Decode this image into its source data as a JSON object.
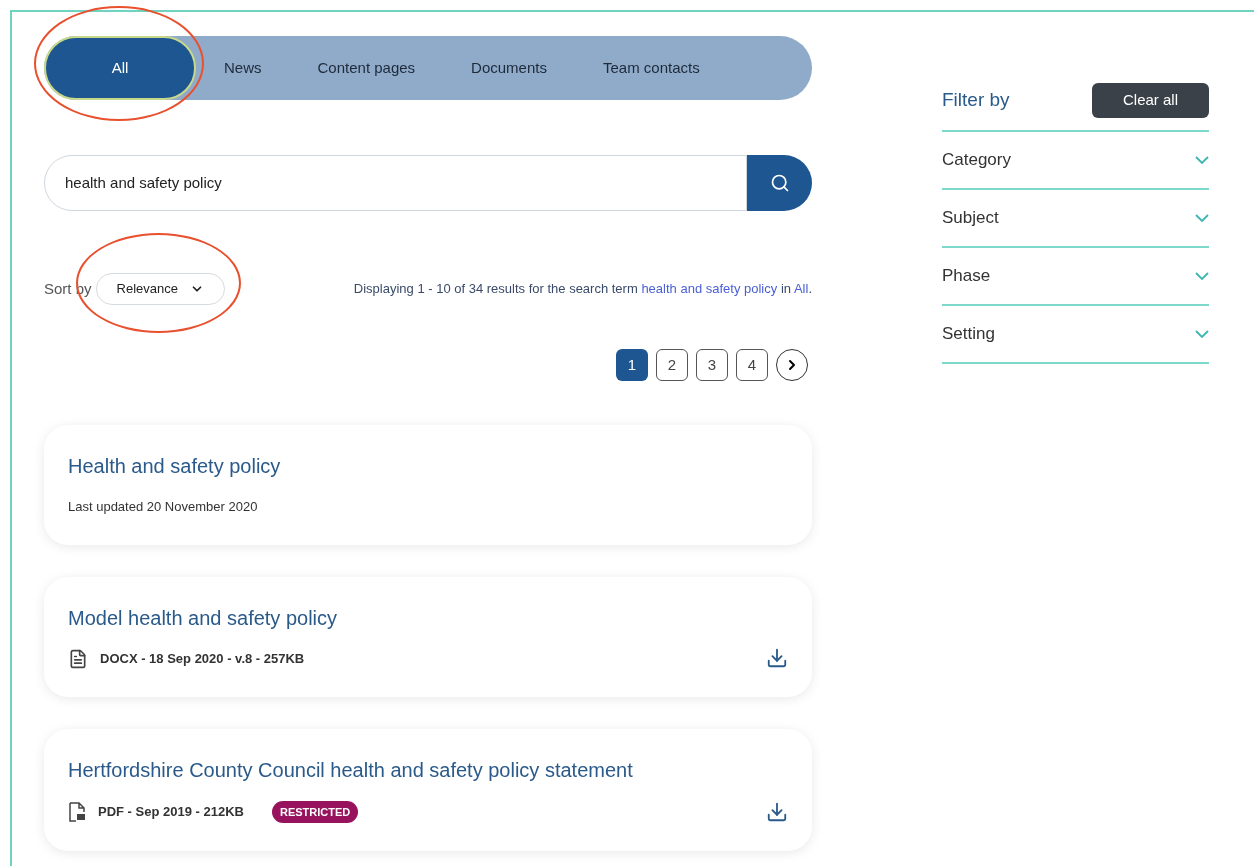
{
  "tabs": [
    {
      "label": "All",
      "selected": true,
      "circled": true
    },
    {
      "label": "News",
      "selected": false,
      "circled": false
    },
    {
      "label": "Content pages",
      "selected": false,
      "circled": false
    },
    {
      "label": "Documents",
      "selected": false,
      "circled": false
    },
    {
      "label": "Team contacts",
      "selected": false,
      "circled": false
    }
  ],
  "search": {
    "value": "health and safety policy"
  },
  "sort": {
    "label": "Sort by",
    "value": "Relevance",
    "circled": true
  },
  "summary": {
    "text": "Displaying 1 - 10 of 34 results for the search term",
    "term": "health and safety policy",
    "joiner": "in",
    "scope": "All",
    "end": "."
  },
  "pagination": [
    {
      "label": "1",
      "selected": true
    },
    {
      "label": "2",
      "selected": false
    },
    {
      "label": "3",
      "selected": false
    },
    {
      "label": "4",
      "selected": false
    }
  ],
  "results": [
    {
      "kind": "page",
      "title": "Health and safety policy",
      "meta": "Last updated 20 November 2020"
    },
    {
      "kind": "docx",
      "title": "Model health and safety policy",
      "meta": "DOCX - 18 Sep 2020 - v.8 - 257KB"
    },
    {
      "kind": "pdf",
      "title": "Hertfordshire County Council health and safety policy statement",
      "meta": "PDF - Sep 2019 - 212KB",
      "badge": "RESTRICTED"
    }
  ],
  "filters": {
    "title": "Filter by",
    "clear": "Clear all",
    "groups": [
      {
        "label": "Category",
        "expanded": false
      },
      {
        "label": "Subject",
        "expanded": false
      },
      {
        "label": "Phase",
        "expanded": false
      },
      {
        "label": "Setting",
        "expanded": false
      }
    ]
  }
}
